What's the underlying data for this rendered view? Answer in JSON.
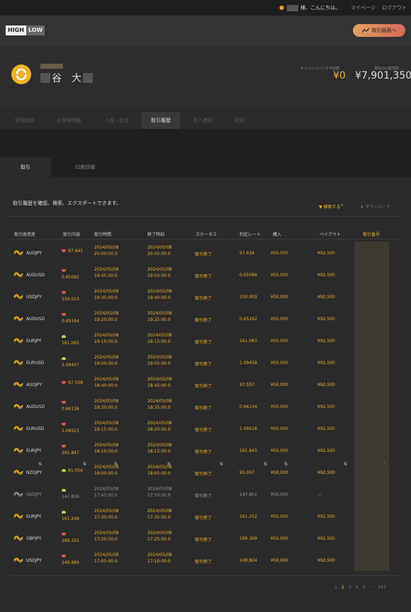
{
  "topbar": {
    "greeting": "様、こんにちは。",
    "mypage": "マイページ",
    "logout": "ログアウト"
  },
  "header": {
    "logo_high": "HIGH",
    "logo_low": "LOW",
    "trade_button": "取引画面へ"
  },
  "account": {
    "name_visible_1": "谷",
    "name_visible_2": "大",
    "cashback_label": "キャッシュバック可能額",
    "cashback": "¥0",
    "balance_label": "現在の口座残高",
    "balance": "¥7,901,350"
  },
  "tabs": [
    {
      "label": "管理画面"
    },
    {
      "label": "お客様情報"
    },
    {
      "label": "入金 / 出金"
    },
    {
      "label": "取引履歴"
    },
    {
      "label": "本人確認"
    },
    {
      "label": "設定"
    }
  ],
  "subtabs": [
    {
      "label": "取引"
    },
    {
      "label": "口座詳細"
    }
  ],
  "description": "取引履歴を確認、検索、エクスポートできます。",
  "filter_label": "検索する",
  "download_label": "ダウンロード",
  "columns": [
    "取引原資産",
    "取引内容",
    "取引時間",
    "終了時刻",
    "ステータス",
    "判定レート",
    "購入",
    "ペイアウト",
    "取引番号"
  ],
  "colors": {
    "accent": "#f2b02a",
    "high": "#b5d45a",
    "low": "#e0504a"
  },
  "rows": [
    {
      "asset": "AUDJPY",
      "dir": "low",
      "strike": "97.641",
      "start_date": "2024/05/08",
      "start_time": "20:00:00.0",
      "end_date": "2024/05/08",
      "end_time": "20:05:00.0",
      "status": "取引終了",
      "rate": "97.634",
      "amount": "¥50,000",
      "payout": "¥92,500"
    },
    {
      "asset": "AUDUSD",
      "dir": "low",
      "strike": "0.65092",
      "start_date": "2024/05/08",
      "start_time": "19:45:00.0",
      "end_date": "2024/05/08",
      "end_time": "19:50:00.0",
      "status": "取引終了",
      "rate": "0.65088",
      "amount": "¥50,000",
      "payout": "¥92,500"
    },
    {
      "asset": "USDJPY",
      "dir": "low",
      "strike": "150.013",
      "start_date": "2024/05/08",
      "start_time": "19:35:00.0",
      "end_date": "2024/05/08",
      "end_time": "19:40:00.0",
      "status": "取引終了",
      "rate": "150.003",
      "amount": "¥50,000",
      "payout": "¥92,500"
    },
    {
      "asset": "AUDUSD",
      "dir": "low",
      "strike": "0.65164",
      "start_date": "2024/05/08",
      "start_time": "19:20:00.0",
      "end_date": "2024/05/08",
      "end_time": "19:25:00.0",
      "status": "取引終了",
      "rate": "0.65162",
      "amount": "¥50,000",
      "payout": "¥92,500"
    },
    {
      "asset": "EURJPY",
      "dir": "high",
      "strike": "161.065",
      "start_date": "2024/05/08",
      "start_time": "19:10:00.0",
      "end_date": "2024/05/08",
      "end_time": "19:15:00.0",
      "status": "取引終了",
      "rate": "161.083",
      "amount": "¥50,000",
      "payout": "¥92,500"
    },
    {
      "asset": "EURUSD",
      "dir": "high",
      "strike": "1.09457",
      "start_date": "2024/05/08",
      "start_time": "19:00:00.0",
      "end_date": "2024/05/08",
      "end_time": "19:05:00.0",
      "status": "取引終了",
      "rate": "1.09458",
      "amount": "¥50,000",
      "payout": "¥92,500"
    },
    {
      "asset": "AUDJPY",
      "dir": "low",
      "strike": "97.559",
      "start_date": "2024/05/08",
      "start_time": "18:40:00.0",
      "end_date": "2024/05/08",
      "end_time": "18:45:00.0",
      "status": "取引終了",
      "rate": "97.557",
      "amount": "¥50,000",
      "payout": "¥92,500"
    },
    {
      "asset": "AUDUSD",
      "dir": "low",
      "strike": "0.66136",
      "start_date": "2024/05/08",
      "start_time": "18:30:00.0",
      "end_date": "2024/05/08",
      "end_time": "18:35:00.0",
      "status": "取引終了",
      "rate": "0.66134",
      "amount": "¥50,000",
      "payout": "¥92,500"
    },
    {
      "asset": "EURUSD",
      "dir": "low",
      "strike": "1.09523",
      "start_date": "2024/05/08",
      "start_time": "18:15:00.0",
      "end_date": "2024/05/08",
      "end_time": "18:20:00.0",
      "status": "取引終了",
      "rate": "1.09518",
      "amount": "¥50,000",
      "payout": "¥92,500"
    },
    {
      "asset": "EURJPY",
      "dir": "low",
      "strike": "161.847",
      "start_date": "2024/05/08",
      "start_time": "18:10:00.0",
      "end_date": "2024/05/08",
      "end_time": "18:15:00.0",
      "status": "取引終了",
      "rate": "161.845",
      "amount": "¥50,000",
      "payout": "¥92,500"
    },
    {
      "asset": "NZDJPY",
      "dir": "high",
      "strike": "91.054",
      "start_date": "2024/05/08",
      "start_time": "18:00:00.0",
      "end_date": "2024/05/08",
      "end_time": "18:05:00.0",
      "status": "取引終了",
      "rate": "91.057",
      "amount": "¥50,000",
      "payout": "¥92,500"
    },
    {
      "asset": "USDJPY",
      "dir": "high",
      "strike": "147.816",
      "start_date": "2024/05/08",
      "start_time": "17:45:00.0",
      "end_date": "2024/05/08",
      "end_time": "17:50:00.0",
      "status": "取引終了",
      "rate": "147.801",
      "amount": "¥50,000",
      "payout": "—",
      "dim": true
    },
    {
      "asset": "EURJPY",
      "dir": "high",
      "strike": "161.248",
      "start_date": "2024/05/08",
      "start_time": "17:30:00.0",
      "end_date": "2024/05/08",
      "end_time": "17:35:00.0",
      "status": "取引終了",
      "rate": "161.252",
      "amount": "¥50,000",
      "payout": "¥92,500"
    },
    {
      "asset": "GBPJPY",
      "dir": "low",
      "strike": "189.325",
      "start_date": "2024/05/08",
      "start_time": "17:20:00.0",
      "end_date": "2024/05/08",
      "end_time": "17:25:00.0",
      "status": "取引終了",
      "rate": "189.309",
      "amount": "¥50,000",
      "payout": "¥92,500"
    },
    {
      "asset": "USDJPY",
      "dir": "low",
      "strike": "149.889",
      "start_date": "2024/05/08",
      "start_time": "17:05:00.0",
      "end_date": "2024/05/08",
      "end_time": "17:10:00.0",
      "status": "取引終了",
      "rate": "149.824",
      "amount": "¥50,000",
      "payout": "¥92,500"
    }
  ],
  "pagination": {
    "pages": [
      "1",
      "2",
      "3",
      "4",
      "5",
      "···",
      "247"
    ],
    "current": "2"
  }
}
